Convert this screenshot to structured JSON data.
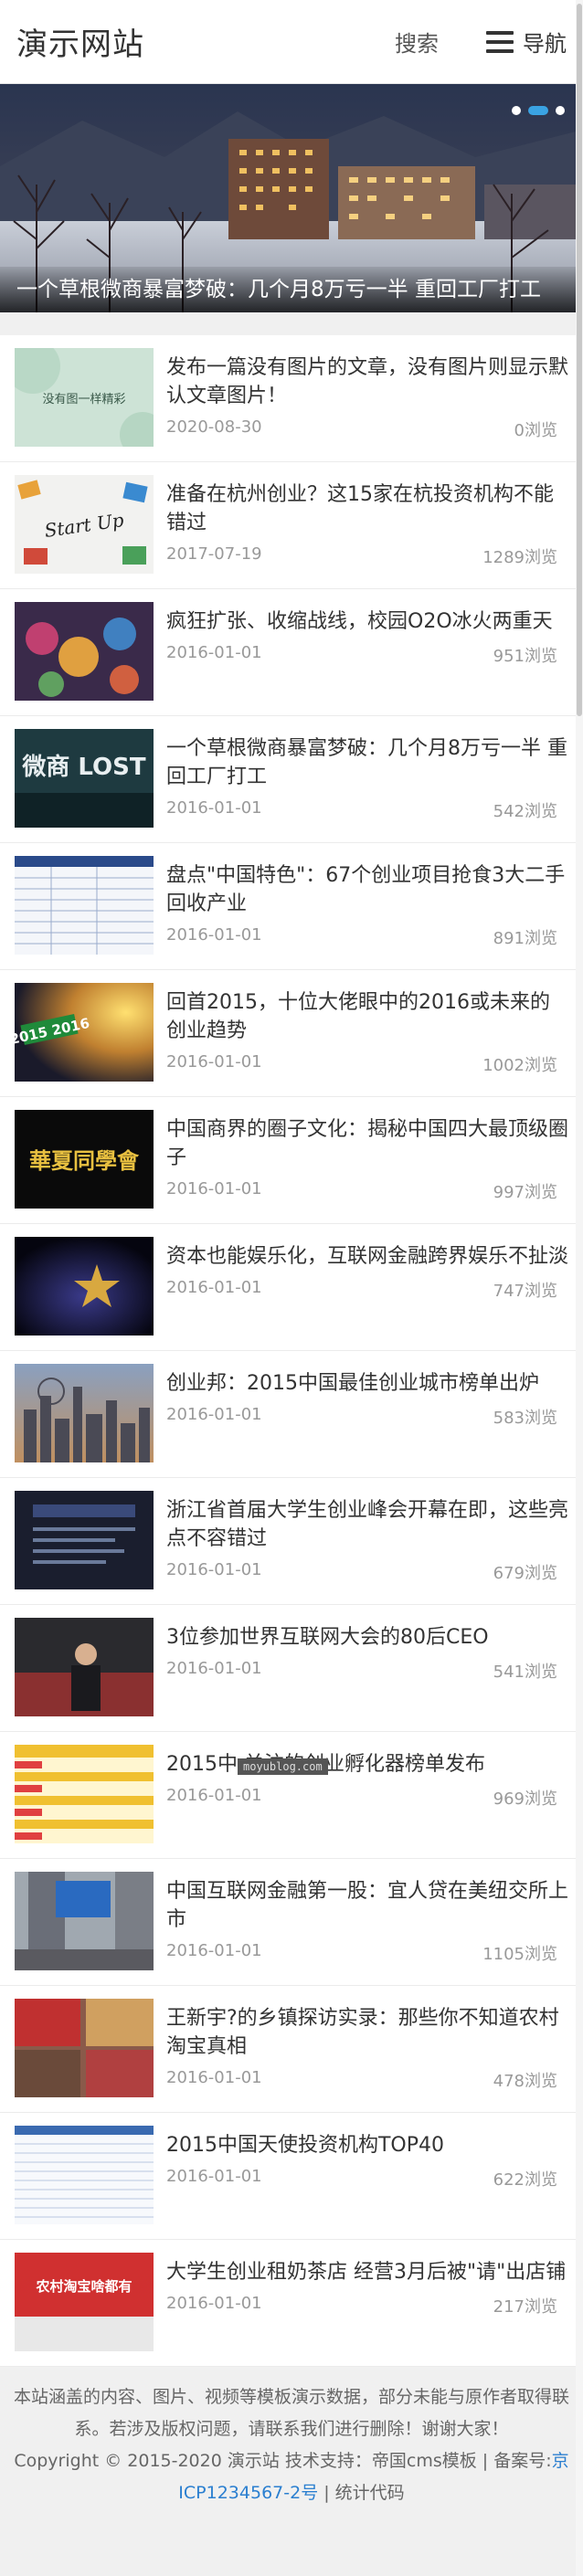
{
  "header": {
    "logo": "演示网站",
    "search_label": "搜索",
    "nav_label": "导航"
  },
  "banner": {
    "caption": "一个草根微商暴富梦破：几个月8万亏一半 重回工厂打工",
    "active_dot": 1,
    "dot_count": 3
  },
  "articles": [
    {
      "title": "发布一篇没有图片的文章，没有图片则显示默认文章图片！",
      "date": "2020-08-30",
      "views": "0浏览",
      "thumb_text": "没有图一样精彩"
    },
    {
      "title": "准备在杭州创业？这15家在杭投资机构不能错过",
      "date": "2017-07-19",
      "views": "1289浏览",
      "thumb_text": "Start Up"
    },
    {
      "title": "疯狂扩张、收缩战线，校园O2O冰火两重天",
      "date": "2016-01-01",
      "views": "951浏览",
      "thumb_text": ""
    },
    {
      "title": "一个草根微商暴富梦破：几个月8万亏一半 重回工厂打工",
      "date": "2016-01-01",
      "views": "542浏览",
      "thumb_text": "微商 LOST"
    },
    {
      "title": "盘点\"中国特色\"：67个创业项目抢食3大二手回收产业",
      "date": "2016-01-01",
      "views": "891浏览",
      "thumb_text": ""
    },
    {
      "title": "回首2015，十位大佬眼中的2016或未来的创业趋势",
      "date": "2016-01-01",
      "views": "1002浏览",
      "thumb_text": "2015 2016"
    },
    {
      "title": "中国商界的圈子文化：揭秘中国四大最顶级圈子",
      "date": "2016-01-01",
      "views": "997浏览",
      "thumb_text": "華夏同學會"
    },
    {
      "title": "资本也能娱乐化，互联网金融跨界娱乐不扯淡",
      "date": "2016-01-01",
      "views": "747浏览",
      "thumb_text": ""
    },
    {
      "title": "创业邦：2015中国最佳创业城市榜单出炉",
      "date": "2016-01-01",
      "views": "583浏览",
      "thumb_text": ""
    },
    {
      "title": "浙江省首届大学生创业峰会开幕在即，这些亮点不容错过",
      "date": "2016-01-01",
      "views": "679浏览",
      "thumb_text": ""
    },
    {
      "title": "3位参加世界互联网大会的80后CEO",
      "date": "2016-01-01",
      "views": "541浏览",
      "thumb_text": ""
    },
    {
      "title": "2015中 关注的创业孵化器榜单发布",
      "date": "2016-01-01",
      "views": "969浏览",
      "thumb_text": ""
    },
    {
      "title": "中国互联网金融第一股：宜人贷在美纽交所上市",
      "date": "2016-01-01",
      "views": "1105浏览",
      "thumb_text": ""
    },
    {
      "title": "王新宇?的乡镇探访实录：那些你不知道农村淘宝真相",
      "date": "2016-01-01",
      "views": "478浏览",
      "thumb_text": ""
    },
    {
      "title": "2015中国天使投资机构TOP40",
      "date": "2016-01-01",
      "views": "622浏览",
      "thumb_text": ""
    },
    {
      "title": "大学生创业租奶茶店 经营3月后被\"请\"出店铺",
      "date": "2016-01-01",
      "views": "217浏览",
      "thumb_text": "农村淘宝啥都有"
    }
  ],
  "watermark": "moyublog.com",
  "footer": {
    "line1": "本站涵盖的内容、图片、视频等模板演示数据，部分未能与原作者取得联系。若涉及版权问题，请联系我们进行删除！谢谢大家！",
    "copyright_prefix": "Copyright © 2015-2020 演示站 技术支持：帝国cms模板 | 备案号:",
    "icp": "京ICP1234567-2号",
    "stats": " | 统计代码"
  },
  "colors": {
    "accent": "#3aa3e3",
    "link": "#2b7fd0"
  }
}
